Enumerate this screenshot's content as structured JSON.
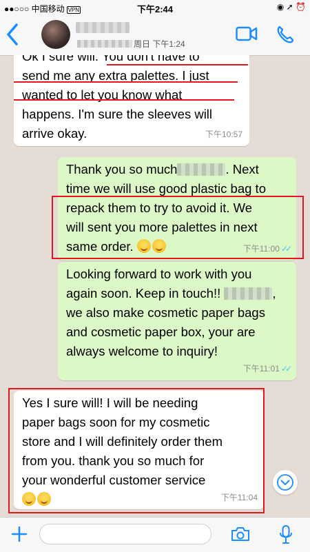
{
  "status_bar": {
    "carrier": "●●○○○ 中国移动",
    "vpn": "VPN",
    "time": "下午2:44",
    "right_icons": "◉ ➚ ⏰"
  },
  "header": {
    "back_icon": "chevron-left-icon",
    "last_seen": "周日 下午1:24",
    "video_icon": "video-call-icon",
    "phone_icon": "phone-icon"
  },
  "messages": [
    {
      "direction": "incoming",
      "lines": [
        "Ok I sure will. You don't have to",
        "send me any extra palettes. I just",
        "wanted to let you know what",
        "happens. I'm sure the sleeves will",
        "arrive okay."
      ],
      "time": "下午10:57"
    },
    {
      "direction": "outgoing",
      "lines": [
        "Thank you so much",
        ". Next",
        "time we will use good plastic bag to",
        "repack them to try to avoid it. We",
        "will sent you more palettes in next",
        "same order. "
      ],
      "time": "下午11:00"
    },
    {
      "direction": "outgoing",
      "lines": [
        "Looking forward to work with you",
        "again soon. Keep in touch!!",
        ",",
        "we also make cosmetic paper bags",
        "and cosmetic paper box, your are",
        "always welcome to inquiry!"
      ],
      "time": "下午11:01"
    },
    {
      "direction": "incoming",
      "lines": [
        "Yes I sure will! I will be needing",
        "paper bags soon for my cosmetic",
        "store and I will definitely order them",
        "from you. thank you so much for",
        "your wonderful customer service"
      ],
      "time": "下午11:04"
    }
  ],
  "annotation_color": "#e3161d",
  "composer": {
    "placeholder": "",
    "plus_icon": "plus-icon",
    "camera_icon": "camera-icon",
    "mic_icon": "microphone-icon"
  },
  "colors": {
    "incoming": "#ffffff",
    "outgoing": "#dcf8c6",
    "accent": "#1a8cff",
    "read_ticks": "#4fc3f7"
  }
}
